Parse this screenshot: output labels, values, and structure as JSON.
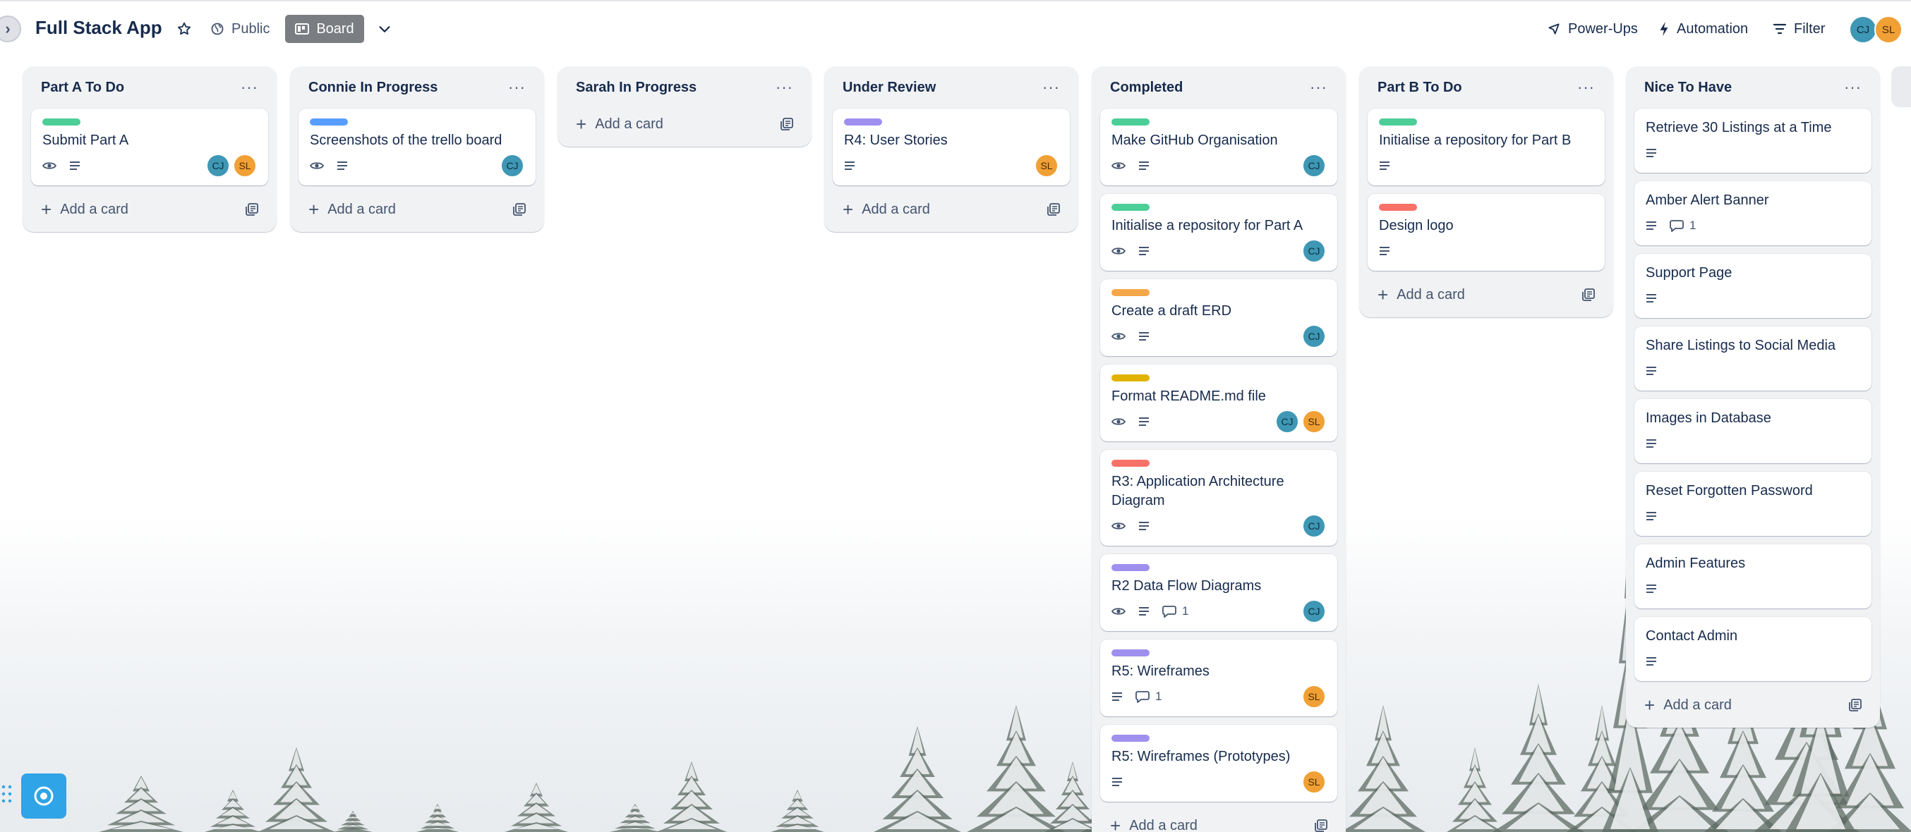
{
  "header": {
    "board_title": "Full Stack App",
    "visibility_label": "Public",
    "view_label": "Board",
    "powerups_label": "Power-Ups",
    "automation_label": "Automation",
    "filter_label": "Filter",
    "members": [
      "CJ",
      "SL"
    ]
  },
  "colors": {
    "green": "#4bce97",
    "blue": "#579dff",
    "purple": "#9f8fef",
    "orange": "#f5a748",
    "yellow": "#e2b203",
    "red": "#f87168",
    "avatar_cj": "#3e97b4",
    "avatar_sl": "#f0a035"
  },
  "add_card_label": "Add a card",
  "lists": [
    {
      "title": "Part A To Do",
      "cards": [
        {
          "title": "Submit Part A",
          "label": "green",
          "watch": true,
          "desc": true,
          "members": [
            "CJ",
            "SL"
          ]
        }
      ]
    },
    {
      "title": "Connie In Progress",
      "cards": [
        {
          "title": "Screenshots of the trello board",
          "label": "blue",
          "watch": true,
          "desc": true,
          "members": [
            "CJ"
          ]
        }
      ]
    },
    {
      "title": "Sarah In Progress",
      "cards": []
    },
    {
      "title": "Under Review",
      "cards": [
        {
          "title": "R4: User Stories",
          "label": "purple",
          "watch": false,
          "desc": true,
          "members": [
            "SL"
          ]
        }
      ]
    },
    {
      "title": "Completed",
      "cards": [
        {
          "title": "Make GitHub Organisation",
          "label": "green",
          "watch": true,
          "desc": true,
          "members": [
            "CJ"
          ]
        },
        {
          "title": "Initialise a repository for Part A",
          "label": "green",
          "watch": true,
          "desc": true,
          "members": [
            "CJ"
          ]
        },
        {
          "title": "Create a draft ERD",
          "label": "orange",
          "watch": true,
          "desc": true,
          "members": [
            "CJ"
          ]
        },
        {
          "title": "Format README.md file",
          "label": "yellow",
          "watch": true,
          "desc": true,
          "members": [
            "CJ",
            "SL"
          ]
        },
        {
          "title": "R3: Application Architecture Diagram",
          "label": "red",
          "watch": true,
          "desc": true,
          "members": [
            "CJ"
          ]
        },
        {
          "title": "R2 Data Flow Diagrams",
          "label": "purple",
          "watch": true,
          "desc": true,
          "comments": "1",
          "members": [
            "CJ"
          ]
        },
        {
          "title": "R5: Wireframes",
          "label": "purple",
          "watch": false,
          "desc": true,
          "comments": "1",
          "members": [
            "SL"
          ]
        },
        {
          "title": "R5: Wireframes (Prototypes)",
          "label": "purple",
          "watch": false,
          "desc": true,
          "members": [
            "SL"
          ]
        }
      ]
    },
    {
      "title": "Part B To Do",
      "cards": [
        {
          "title": "Initialise a repository for Part B",
          "label": "green",
          "watch": false,
          "desc": true,
          "members": []
        },
        {
          "title": "Design logo",
          "label": "red",
          "watch": false,
          "desc": true,
          "members": []
        }
      ]
    },
    {
      "title": "Nice To Have",
      "cards": [
        {
          "title": "Retrieve 30 Listings at a Time",
          "desc": true,
          "members": []
        },
        {
          "title": "Amber Alert Banner",
          "desc": true,
          "comments": "1",
          "members": []
        },
        {
          "title": "Support Page",
          "desc": true,
          "members": []
        },
        {
          "title": "Share Listings to Social Media",
          "desc": true,
          "members": []
        },
        {
          "title": "Images in Database",
          "desc": true,
          "members": []
        },
        {
          "title": "Reset Forgotten Password",
          "desc": true,
          "members": []
        },
        {
          "title": "Admin Features",
          "desc": true,
          "members": []
        },
        {
          "title": "Contact Admin",
          "desc": true,
          "members": []
        }
      ]
    }
  ]
}
